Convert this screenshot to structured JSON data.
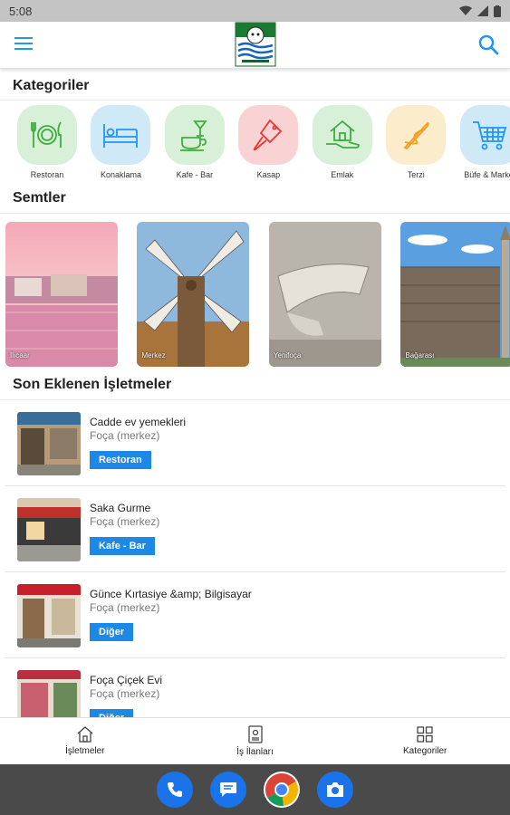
{
  "status": {
    "time": "5:08"
  },
  "header": {
    "logo_alt": "logo"
  },
  "sections": {
    "categories_title": "Kategoriler",
    "districts_title": "Semtler",
    "recent_title": "Son Eklenen İşletmeler"
  },
  "categories": [
    {
      "label": "Restoran",
      "icon": "restaurant-icon",
      "bg": "#d8f0d8"
    },
    {
      "label": "Konaklama",
      "icon": "bed-icon",
      "bg": "#cfe9f7"
    },
    {
      "label": "Kafe - Bar",
      "icon": "cafe-icon",
      "bg": "#d8f0d8"
    },
    {
      "label": "Kasap",
      "icon": "cleaver-icon",
      "bg": "#f9d3d3"
    },
    {
      "label": "Emlak",
      "icon": "house-hand-icon",
      "bg": "#d8f0d8"
    },
    {
      "label": "Terzi",
      "icon": "needle-icon",
      "bg": "#fbeccc"
    },
    {
      "label": "Büfe & Market",
      "icon": "cart-icon",
      "bg": "#cfe9f7"
    }
  ],
  "districts": [
    {
      "label": "İlıcaar"
    },
    {
      "label": "Merkez"
    },
    {
      "label": "Yenifoça"
    },
    {
      "label": "Bağarası"
    }
  ],
  "businesses": [
    {
      "name": "Cadde ev yemekleri",
      "location": "Foça (merkez)",
      "category": "Restoran"
    },
    {
      "name": "Saka Gurme",
      "location": "Foça (merkez)",
      "category": "Kafe - Bar"
    },
    {
      "name": "Günce Kırtasiye &amp; Bilgisayar",
      "location": "Foça (merkez)",
      "category": "Diğer"
    },
    {
      "name": "Foça Çiçek Evi",
      "location": "Foça (merkez)",
      "category": "Diğer"
    }
  ],
  "bottom_nav": {
    "businesses": "İşletmeler",
    "jobs": "İş İlanları",
    "categories": "Kategoriler"
  },
  "colors": {
    "accent": "#2196f3",
    "tag": "#1e88e5"
  }
}
